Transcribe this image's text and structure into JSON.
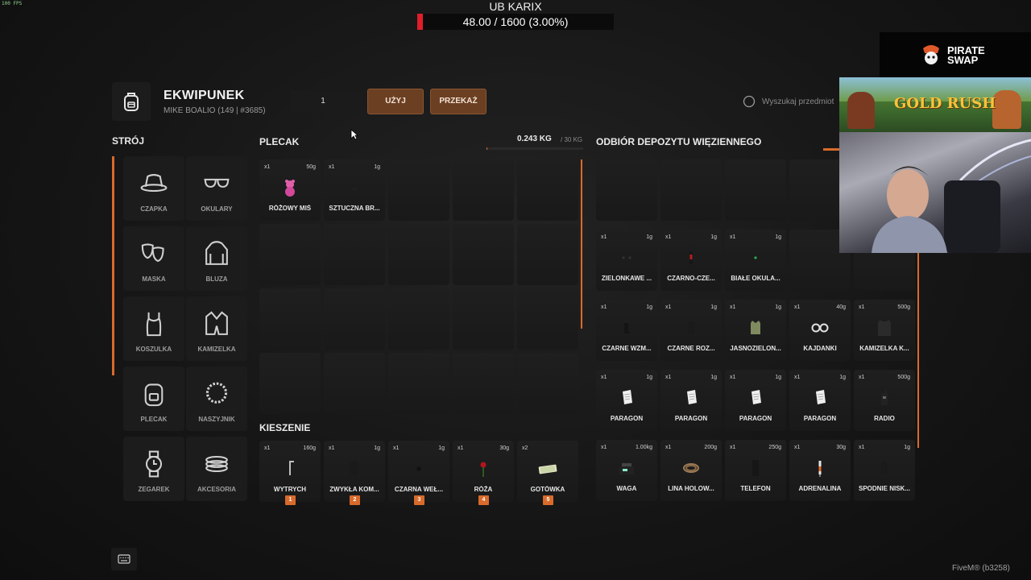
{
  "hud": {
    "fps": "100 FPS",
    "boss_name": "UB KARIX",
    "boss_progress": "48.00 / 1600 (3.00%)",
    "boss_fraction": 0.03
  },
  "header": {
    "title": "EKWIPUNEK",
    "subtitle": "MIKE BOALIO (149 | #3685)",
    "quantity": "1",
    "use_label": "UŻYJ",
    "give_label": "PRZEKAŻ",
    "search_placeholder": "Wyszukaj przedmiot"
  },
  "outfit": {
    "title": "STRÓJ",
    "slots": [
      "CZAPKA",
      "OKULARY",
      "MASKA",
      "BLUZA",
      "KOSZULKA",
      "KAMIZELKA",
      "PLECAK",
      "NASZYJNIK",
      "ZEGAREK",
      "AKCESORIA"
    ]
  },
  "backpack": {
    "title": "PLECAK",
    "weight": "0.243 KG",
    "capacity": "/ 30 KG",
    "fill_fraction": 0.0081,
    "items": [
      {
        "count": "x1",
        "weight": "50g",
        "label": "RÓŻOWY MIŚ",
        "icon": "teddy-bear-icon"
      },
      {
        "count": "x1",
        "weight": "1g",
        "label": "SZTUCZNA BR...",
        "icon": "fake-beard-icon"
      }
    ]
  },
  "pockets": {
    "title": "KIESZENIE",
    "items": [
      {
        "count": "x1",
        "weight": "160g",
        "label": "WYTRYCH",
        "hotkey": "1",
        "icon": "lockpick-icon"
      },
      {
        "count": "x1",
        "weight": "1g",
        "label": "ZWYKŁA KOM...",
        "hotkey": "2",
        "icon": "shirt-icon"
      },
      {
        "count": "x1",
        "weight": "1g",
        "label": "CZARNA WEŁ...",
        "hotkey": "3",
        "icon": "beanie-icon"
      },
      {
        "count": "x1",
        "weight": "30g",
        "label": "RÓŻA",
        "hotkey": "4",
        "icon": "rose-icon"
      },
      {
        "count": "x2",
        "weight": "",
        "label": "GOTÓWKA",
        "hotkey": "5",
        "icon": "cash-icon"
      }
    ]
  },
  "deposit": {
    "title": "ODBIÓR DEPOZYTU WIĘZIENNEGO",
    "items": [
      {
        "count": "x1",
        "weight": "1g",
        "label": "ZIELONKAWE ...",
        "icon": "earrings-icon"
      },
      {
        "count": "x1",
        "weight": "1g",
        "label": "CZARNO-CZE...",
        "icon": "bracelet-icon"
      },
      {
        "count": "x1",
        "weight": "1g",
        "label": "BIAŁE OKULA...",
        "icon": "glasses-icon"
      },
      {
        "count": "x1",
        "weight": "1g",
        "label": "CZARNE WZM...",
        "icon": "boots-icon"
      },
      {
        "count": "x1",
        "weight": "1g",
        "label": "CZARNE ROZ...",
        "icon": "pants-icon"
      },
      {
        "count": "x1",
        "weight": "1g",
        "label": "JASNOZIELON...",
        "icon": "vest-icon"
      },
      {
        "count": "x1",
        "weight": "40g",
        "label": "KAJDANKI",
        "icon": "handcuffs-icon"
      },
      {
        "count": "x1",
        "weight": "500g",
        "label": "KAMIZELKA K...",
        "icon": "armor-vest-icon"
      },
      {
        "count": "x1",
        "weight": "1g",
        "label": "PARAGON",
        "icon": "receipt-icon"
      },
      {
        "count": "x1",
        "weight": "1g",
        "label": "PARAGON",
        "icon": "receipt-icon"
      },
      {
        "count": "x1",
        "weight": "1g",
        "label": "PARAGON",
        "icon": "receipt-icon"
      },
      {
        "count": "x1",
        "weight": "1g",
        "label": "PARAGON",
        "icon": "receipt-icon"
      },
      {
        "count": "x1",
        "weight": "500g",
        "label": "RADIO",
        "icon": "radio-icon"
      },
      {
        "count": "x1",
        "weight": "1.00kg",
        "label": "WAGA",
        "icon": "scale-icon"
      },
      {
        "count": "x1",
        "weight": "200g",
        "label": "LINA HOLOW...",
        "icon": "rope-icon"
      },
      {
        "count": "x1",
        "weight": "250g",
        "label": "TELEFON",
        "icon": "phone-icon"
      },
      {
        "count": "x1",
        "weight": "30g",
        "label": "ADRENALINA",
        "icon": "syringe-icon"
      },
      {
        "count": "x1",
        "weight": "1g",
        "label": "SPODNIE NISK...",
        "icon": "pants-icon"
      }
    ]
  },
  "overlay": {
    "sponsor_top": "PIRATE",
    "sponsor_bottom": "SWAP",
    "game_banner": "GOLD RUSH",
    "client_version": "FiveM® (b3258)"
  },
  "colors": {
    "accent": "#d86a2b",
    "button": "#6b3f22",
    "health_red": "#e01e2a"
  }
}
